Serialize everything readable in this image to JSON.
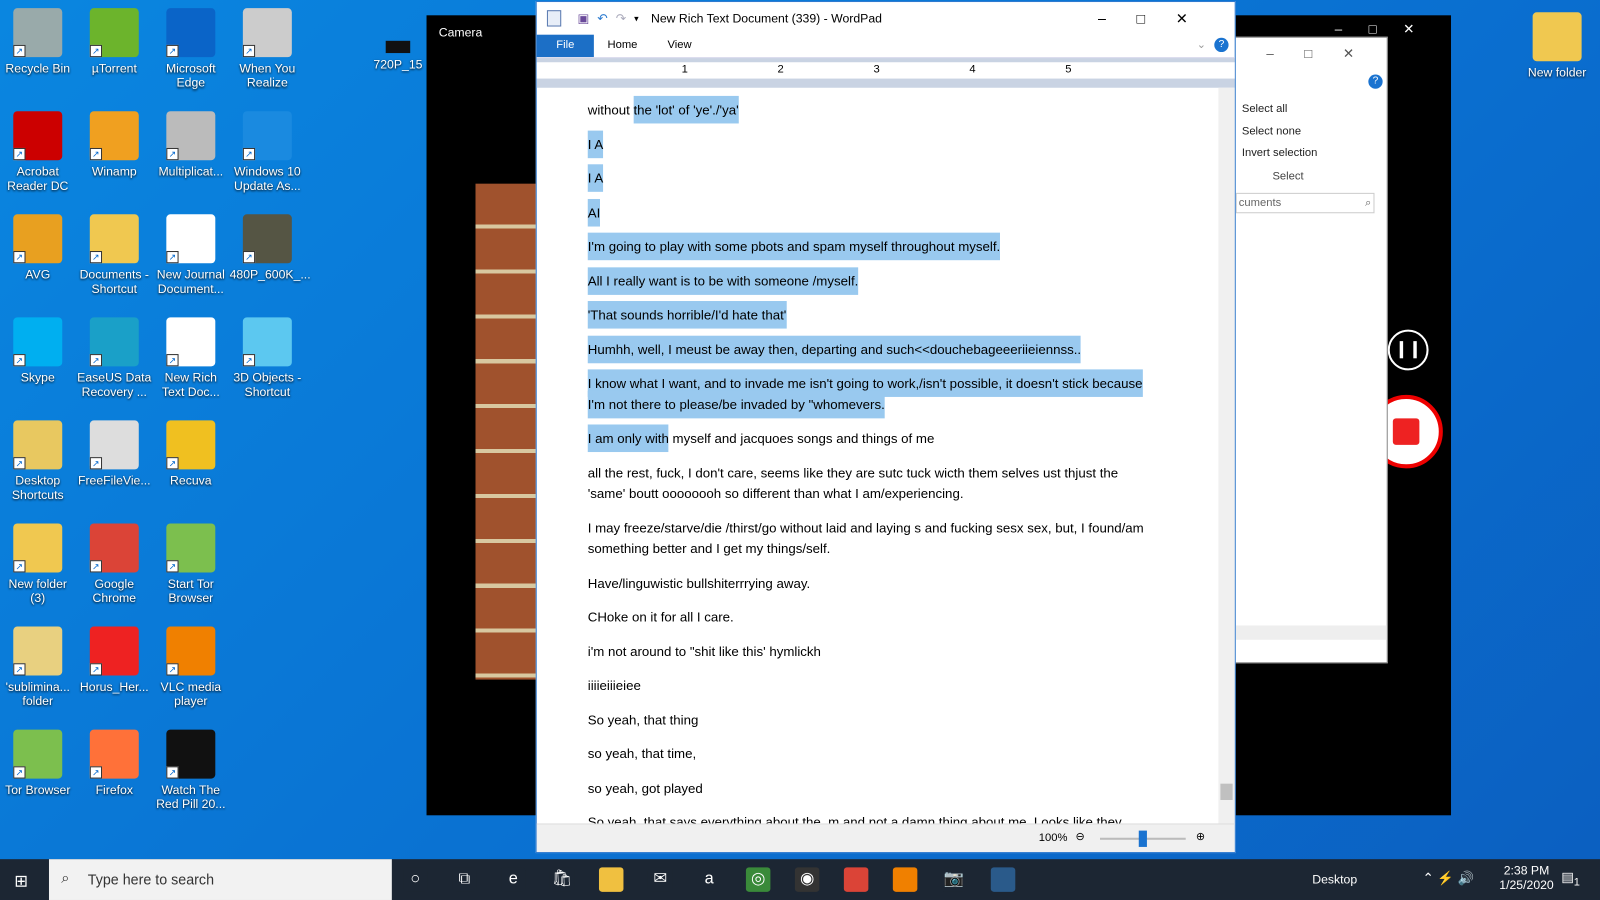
{
  "desktop_icons": [
    {
      "label": "Recycle Bin",
      "col": 0,
      "row": 0,
      "color": "#9aa"
    },
    {
      "label": "Acrobat Reader DC",
      "col": 0,
      "row": 1,
      "color": "#c00"
    },
    {
      "label": "AVG",
      "col": 0,
      "row": 2,
      "color": "#e8a020"
    },
    {
      "label": "Skype",
      "col": 0,
      "row": 3,
      "color": "#00aff0"
    },
    {
      "label": "Desktop Shortcuts",
      "col": 0,
      "row": 4,
      "color": "#e8c860"
    },
    {
      "label": "New folder (3)",
      "col": 0,
      "row": 5,
      "color": "#f0c850"
    },
    {
      "label": "'sublimina... folder",
      "col": 0,
      "row": 6,
      "color": "#e8d080"
    },
    {
      "label": "Tor Browser",
      "col": 0,
      "row": 7,
      "color": "#7cbf4e"
    },
    {
      "label": "µTorrent",
      "col": 1,
      "row": 0,
      "color": "#6cb42c"
    },
    {
      "label": "Winamp",
      "col": 1,
      "row": 1,
      "color": "#f0a020"
    },
    {
      "label": "Documents - Shortcut",
      "col": 1,
      "row": 2,
      "color": "#f0c850"
    },
    {
      "label": "EaseUS Data Recovery ...",
      "col": 1,
      "row": 3,
      "color": "#1aa0c8"
    },
    {
      "label": "FreeFileVie...",
      "col": 1,
      "row": 4,
      "color": "#ddd"
    },
    {
      "label": "Google Chrome",
      "col": 1,
      "row": 5,
      "color": "#db4437"
    },
    {
      "label": "Horus_Her...",
      "col": 1,
      "row": 6,
      "color": "#e22"
    },
    {
      "label": "Firefox",
      "col": 1,
      "row": 7,
      "color": "#ff7139"
    },
    {
      "label": "Microsoft Edge",
      "col": 2,
      "row": 0,
      "color": "#0a64c8"
    },
    {
      "label": "Multiplicat...",
      "col": 2,
      "row": 1,
      "color": "#bbb"
    },
    {
      "label": "New Journal Document...",
      "col": 2,
      "row": 2,
      "color": "#fff"
    },
    {
      "label": "New Rich Text Doc...",
      "col": 2,
      "row": 3,
      "color": "#fff"
    },
    {
      "label": "Recuva",
      "col": 2,
      "row": 4,
      "color": "#f0c020"
    },
    {
      "label": "Start Tor Browser",
      "col": 2,
      "row": 5,
      "color": "#7cbf4e"
    },
    {
      "label": "VLC media player",
      "col": 2,
      "row": 6,
      "color": "#f08000"
    },
    {
      "label": "Watch The Red Pill 20...",
      "col": 2,
      "row": 7,
      "color": "#111"
    },
    {
      "label": "When You Realize",
      "col": 3,
      "row": 0,
      "color": "#ccc"
    },
    {
      "label": "Windows 10 Update As...",
      "col": 3,
      "row": 1,
      "color": "#1a8ae0"
    },
    {
      "label": "480P_600K_...",
      "col": 3,
      "row": 2,
      "color": "#554"
    },
    {
      "label": "3D Objects - Shortcut",
      "col": 3,
      "row": 3,
      "color": "#5cc8f0"
    }
  ],
  "partial_icon": "720P_15",
  "new_folder": "New folder",
  "camera": {
    "title": "Camera"
  },
  "explorer": {
    "select_all": "Select all",
    "select_none": "Select none",
    "invert": "Invert selection",
    "group": "Select",
    "search": "cuments"
  },
  "wordpad": {
    "title": "New Rich Text Document (339) - WordPad",
    "tabs": [
      "File",
      "Home",
      "View"
    ],
    "ruler": [
      "1",
      "2",
      "3",
      "4",
      "5"
    ],
    "zoom": "100%",
    "paragraphs": [
      {
        "pre": "without ",
        "sel": "the 'lot' of 'ye'./'ya'",
        "post": ""
      },
      {
        "pre": "",
        "sel": "I A",
        "post": ""
      },
      {
        "pre": "",
        "sel": "I A",
        "post": ""
      },
      {
        "pre": "",
        "sel": "AI",
        "post": ""
      },
      {
        "pre": "",
        "sel": "I'm going to play with some pbots and spam myself throughout myself.",
        "post": ""
      },
      {
        "pre": "",
        "sel": "All I really want is to be with someone /myself.",
        "post": ""
      },
      {
        "pre": "",
        "sel": "'That sounds horrible/I'd hate that'",
        "post": ""
      },
      {
        "pre": "",
        "sel": "Humhh, well, I meust be away then, departing and such<<douchebageeeriieiennss..",
        "post": ""
      },
      {
        "pre": "",
        "sel": "I know what I want, and to invade me isn't going to work,/isn't possible, it doesn't stick because I'm not there to please/be invaded by \"whomevers.",
        "post": ""
      },
      {
        "pre": "",
        "sel": "I am only with",
        "post": " myself and jacquoes songs and things of me"
      },
      {
        "pre": "all the rest, fuck, I don't care, seems like they are sutc tuck wicth them selves ust thjust the 'same' boutt oooooooh so different than what I am/experiencing.",
        "sel": "",
        "post": ""
      },
      {
        "pre": "I may freeze/starve/die /thirst/go without laid and laying s and fucking sesx sex, but, I found/am something better and I get my things/self.",
        "sel": "",
        "post": ""
      },
      {
        "pre": "Have/linguwistic bullshiterrrying away.",
        "sel": "",
        "post": ""
      },
      {
        "pre": "CHoke on it for all I care.",
        "sel": "",
        "post": ""
      },
      {
        "pre": "i'm not around to \"shit like this' hymlickh",
        "sel": "",
        "post": ""
      },
      {
        "pre": "iiiieiiieiee",
        "sel": "",
        "post": ""
      },
      {
        "pre": "So yeah, that thing",
        "sel": "",
        "post": ""
      },
      {
        "pre": "so yeah, that time,",
        "sel": "",
        "post": ""
      },
      {
        "pre": "so yeah, got played",
        "sel": "",
        "post": ""
      },
      {
        "pre": "So yeah, that says everything about the, m and not a damn thing about me. Looks like they",
        "sel": "",
        "post": ""
      }
    ]
  },
  "taskbar": {
    "search_placeholder": "Type here to search",
    "desktop": "Desktop",
    "time": "2:38 PM",
    "date": "1/25/2020",
    "notifications": "1"
  },
  "colors": {
    "accent": "#2b78d0",
    "selection": "#99c9ef",
    "taskbar": "#1c2633"
  }
}
